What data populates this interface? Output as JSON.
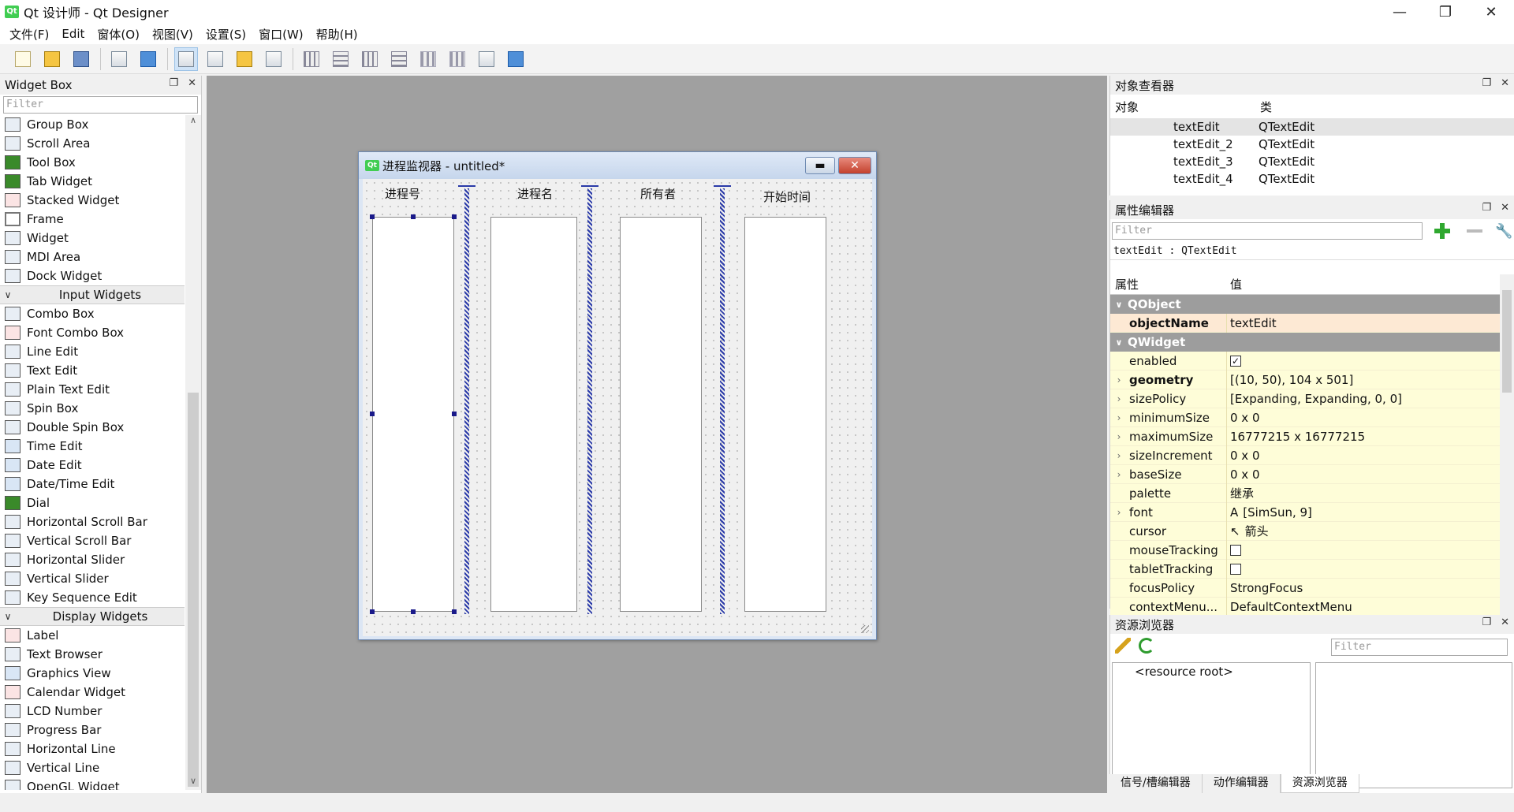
{
  "window": {
    "title": "Qt 设计师 - Qt Designer",
    "controls": [
      "—",
      "❐",
      "✕"
    ]
  },
  "menubar": [
    "文件(F)",
    "Edit",
    "窗体(O)",
    "视图(V)",
    "设置(S)",
    "窗口(W)",
    "帮助(H)"
  ],
  "widget_box": {
    "title": "Widget Box",
    "filter_placeholder": "Filter",
    "groups": [
      {
        "category": null,
        "items": [
          "Group Box",
          "Scroll Area",
          "Tool Box",
          "Tab Widget",
          "Stacked Widget",
          "Frame",
          "Widget",
          "MDI Area",
          "Dock Widget"
        ]
      },
      {
        "category": "Input Widgets",
        "items": [
          "Combo Box",
          "Font Combo Box",
          "Line Edit",
          "Text Edit",
          "Plain Text Edit",
          "Spin Box",
          "Double Spin Box",
          "Time Edit",
          "Date Edit",
          "Date/Time Edit",
          "Dial",
          "Horizontal Scroll Bar",
          "Vertical Scroll Bar",
          "Horizontal Slider",
          "Vertical Slider",
          "Key Sequence Edit"
        ]
      },
      {
        "category": "Display Widgets",
        "items": [
          "Label",
          "Text Browser",
          "Graphics View",
          "Calendar Widget",
          "LCD Number",
          "Progress Bar",
          "Horizontal Line",
          "Vertical Line",
          "OpenGL Widget"
        ]
      }
    ]
  },
  "form": {
    "icon_text": "Qt",
    "title": "进程监视器 - untitled*",
    "columns": [
      "进程号",
      "进程名",
      "所有者",
      "开始时间"
    ]
  },
  "object_inspector": {
    "title": "对象查看器",
    "headers": [
      "对象",
      "类"
    ],
    "rows": [
      {
        "object": "textEdit",
        "class": "QTextEdit"
      },
      {
        "object": "textEdit_2",
        "class": "QTextEdit"
      },
      {
        "object": "textEdit_3",
        "class": "QTextEdit"
      },
      {
        "object": "textEdit_4",
        "class": "QTextEdit"
      }
    ]
  },
  "property_editor": {
    "title": "属性编辑器",
    "filter_placeholder": "Filter",
    "context": "textEdit : QTextEdit",
    "headers": [
      "属性",
      "值"
    ],
    "groups": [
      {
        "name": "QObject",
        "rows": [
          {
            "name": "objectName",
            "value": "textEdit",
            "bold": true
          }
        ]
      },
      {
        "name": "QWidget",
        "rows": [
          {
            "name": "enabled",
            "value": "",
            "checkbox": true,
            "checked": true
          },
          {
            "name": "geometry",
            "value": "[(10, 50), 104 x 501]",
            "bold": true,
            "expandable": true
          },
          {
            "name": "sizePolicy",
            "value": "[Expanding, Expanding, 0, 0]",
            "expandable": true
          },
          {
            "name": "minimumSize",
            "value": "0 x 0",
            "expandable": true
          },
          {
            "name": "maximumSize",
            "value": "16777215 x 16777215",
            "expandable": true
          },
          {
            "name": "sizeIncrement",
            "value": "0 x 0",
            "expandable": true
          },
          {
            "name": "baseSize",
            "value": "0 x 0",
            "expandable": true
          },
          {
            "name": "palette",
            "value": "继承"
          },
          {
            "name": "font",
            "value": "[SimSun, 9]",
            "expandable": true,
            "icon": "A"
          },
          {
            "name": "cursor",
            "value": "箭头",
            "icon": "↖"
          },
          {
            "name": "mouseTracking",
            "value": "",
            "checkbox": true,
            "checked": false
          },
          {
            "name": "tabletTracking",
            "value": "",
            "checkbox": true,
            "checked": false
          },
          {
            "name": "focusPolicy",
            "value": "StrongFocus"
          },
          {
            "name": "contextMenu...",
            "value": "DefaultContextMenu"
          }
        ]
      }
    ]
  },
  "resource_browser": {
    "title": "资源浏览器",
    "filter_placeholder": "Filter",
    "root": "<resource root>"
  },
  "bottom_tabs": [
    "信号/槽编辑器",
    "动作编辑器",
    "资源浏览器"
  ],
  "colors": {
    "group_header": "#9d9d9d",
    "qobject_row": "#fde9d4",
    "qwidget_row": "#fefdd8",
    "mdi_background": "#a0a0a0",
    "spacer": "#2a3aa8"
  }
}
